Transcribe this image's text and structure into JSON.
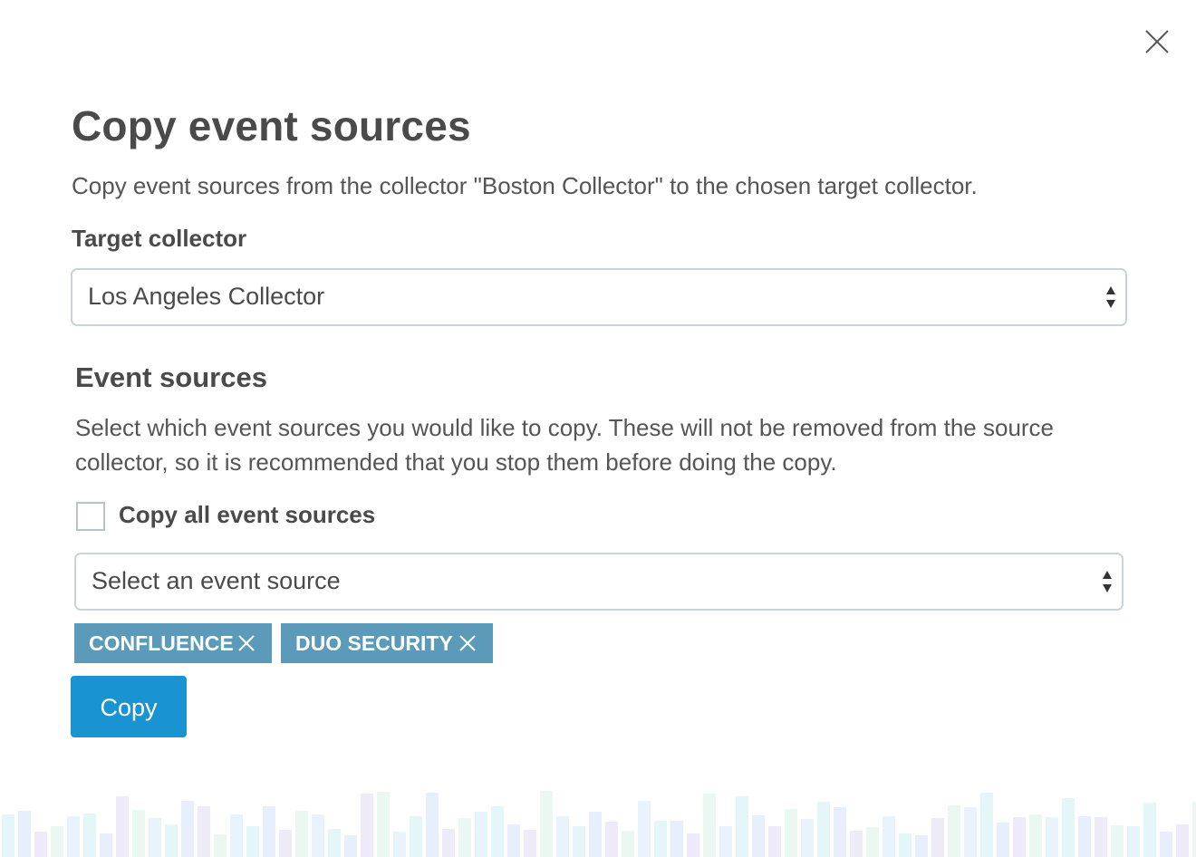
{
  "dialog": {
    "title": "Copy event sources",
    "subtitle": "Copy event sources from the collector \"Boston Collector\" to the chosen target collector.",
    "close_icon": "close-icon"
  },
  "target": {
    "label": "Target collector",
    "selected": "Los Angeles Collector"
  },
  "event_sources": {
    "heading": "Event sources",
    "description": "Select which event sources you would like to copy. These will not be removed from the source collector, so it is recommended that you stop them before doing the copy.",
    "copy_all_label": "Copy all event sources",
    "copy_all_checked": false,
    "select_placeholder": "Select an event source",
    "selected_tags": [
      "CONFLUENCE",
      "DUO SECURITY"
    ]
  },
  "actions": {
    "copy_label": "Copy"
  },
  "colors": {
    "tag_bg": "#5b9ab8",
    "button_bg": "#1a93d2",
    "border": "#c9d3da",
    "text": "#4a4a4a"
  }
}
